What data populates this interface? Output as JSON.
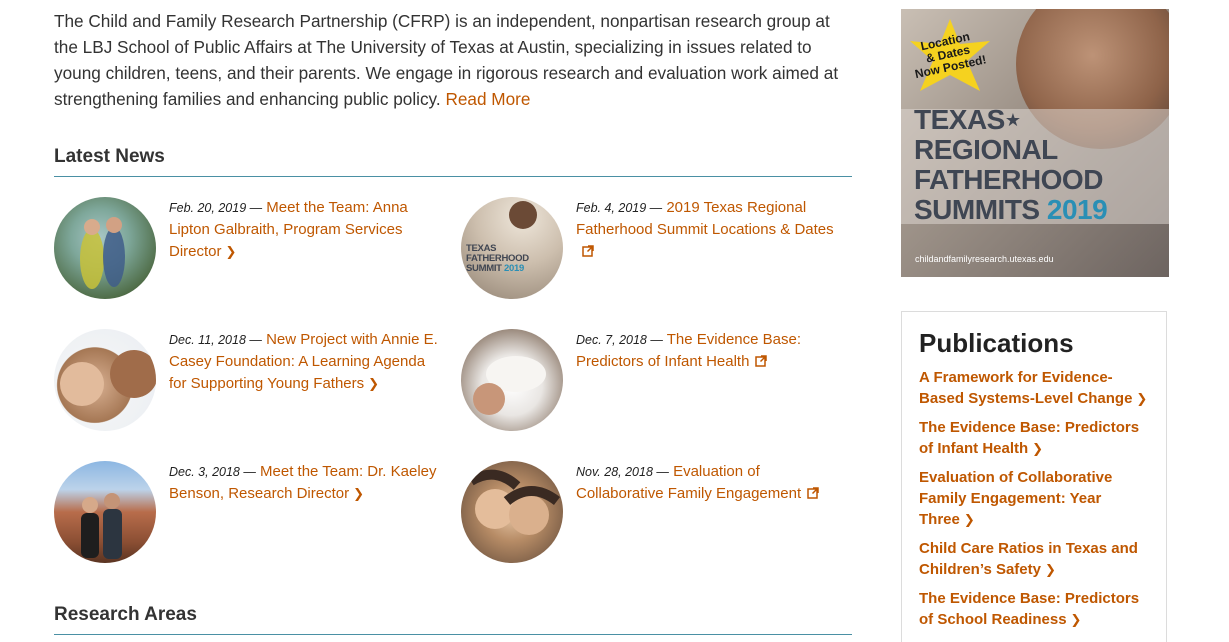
{
  "intro": {
    "text": "The Child and Family Research Partnership (CFRP) is an independent, nonpartisan research group at the LBJ School of Public Affairs at The University of Texas at Austin, specializing in issues related to young children, teens, and their parents. We engage in rigorous research and evaluation work aimed at strengthening families and enhancing public policy.",
    "read_more": "Read More"
  },
  "latest_news": {
    "heading": "Latest News",
    "items": [
      {
        "date": "Feb. 20, 2019 —",
        "title": "Meet the Team: Anna Lipton Galbraith, Program Services Director",
        "link_icon": "chevron-right-icon"
      },
      {
        "date": "Feb. 4, 2019 —",
        "title": "2019 Texas Regional Fatherhood Summit Locations & Dates",
        "link_icon": "external-link-icon",
        "thumb_text": [
          "TEXAS",
          "FATHERHOOD",
          "SUMMIT"
        ],
        "thumb_year": "2019"
      },
      {
        "date": "Dec. 11, 2018 —",
        "title": "New Project with Annie E. Casey Foundation: A Learning Agenda for Supporting Young Fathers",
        "link_icon": "chevron-right-icon"
      },
      {
        "date": "Dec. 7, 2018 —",
        "title": "The Evidence Base: Predictors of Infant Health",
        "link_icon": "external-link-icon"
      },
      {
        "date": "Dec. 3, 2018 —",
        "title": "Meet the Team: Dr. Kaeley Benson, Research Director",
        "link_icon": "chevron-right-icon"
      },
      {
        "date": "Nov. 28, 2018 —",
        "title": "Evaluation of Collaborative Family Engagement",
        "link_icon": "external-link-icon"
      }
    ]
  },
  "research_areas": {
    "heading": "Research Areas"
  },
  "ad": {
    "badge": [
      "Location",
      "& Dates",
      "Now Posted!"
    ],
    "title_lines": [
      "TEXAS",
      "REGIONAL",
      "FATHERHOOD",
      "SUMMITS"
    ],
    "year": "2019",
    "url": "childandfamilyresearch.utexas.edu"
  },
  "publications": {
    "heading": "Publications",
    "items": [
      {
        "title": "A Framework for Evidence-Based Systems-Level Change"
      },
      {
        "title": "The Evidence Base: Predictors of Infant Health"
      },
      {
        "title": "Evaluation of Collaborative Family Engagement: Year Three"
      },
      {
        "title": "Child Care Ratios in Texas and Children’s Safety"
      },
      {
        "title": "The Evidence Base: Predictors of School Readiness"
      }
    ]
  },
  "colors": {
    "link": "#bf5700",
    "rule": "#4a90a4",
    "accent_blue": "#2a8fb5",
    "badge_yellow": "#f5d21f"
  }
}
